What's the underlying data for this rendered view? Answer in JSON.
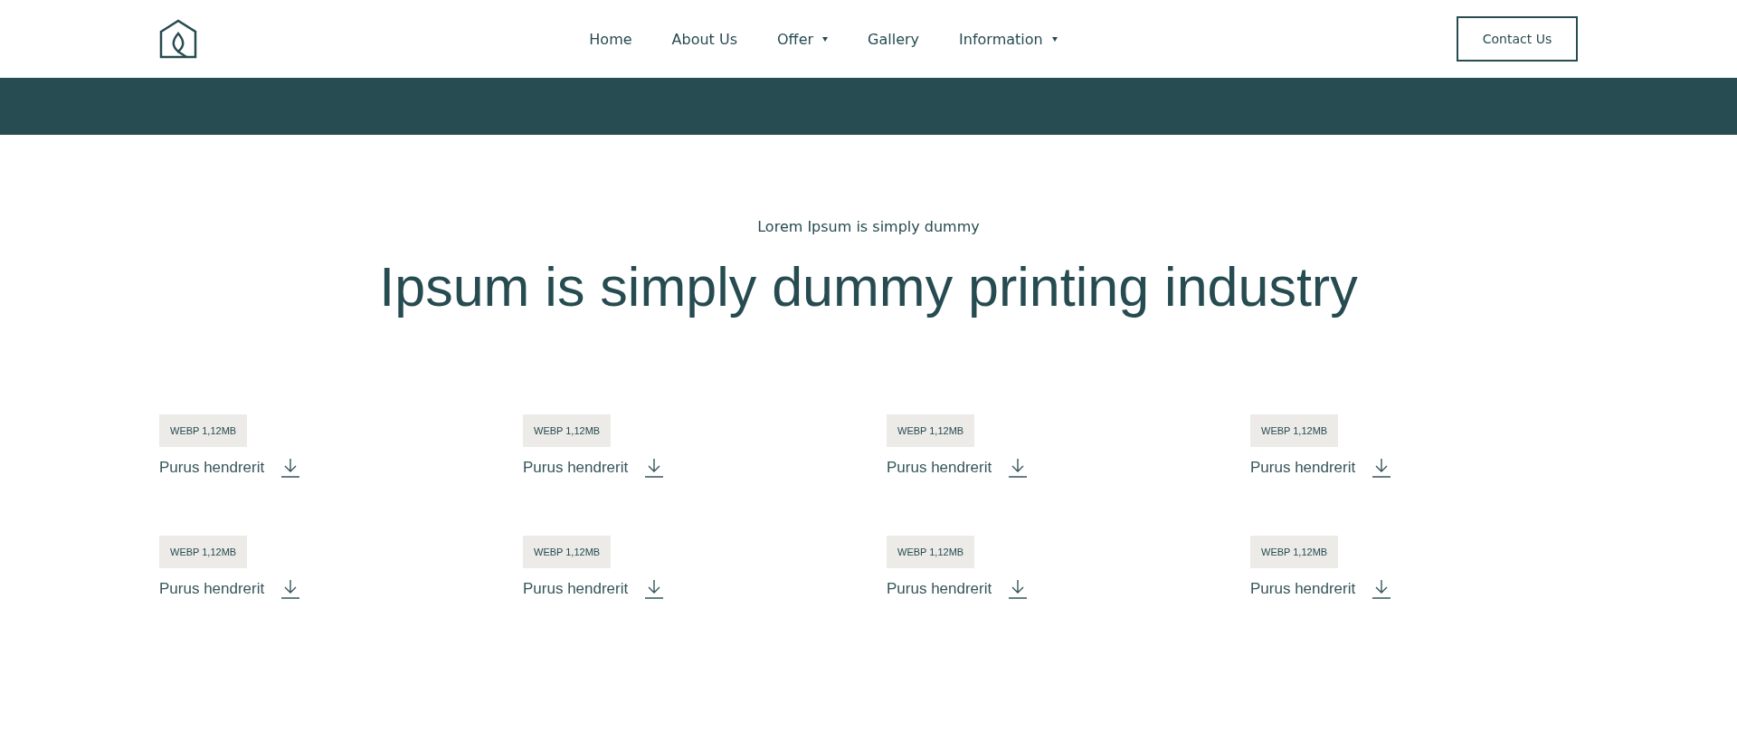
{
  "nav": {
    "items": [
      {
        "label": "Home",
        "has_dropdown": false
      },
      {
        "label": "About Us",
        "has_dropdown": false
      },
      {
        "label": "Offer",
        "has_dropdown": true
      },
      {
        "label": "Gallery",
        "has_dropdown": false
      },
      {
        "label": "Information",
        "has_dropdown": true
      }
    ],
    "cta": "Contact Us"
  },
  "section": {
    "eyebrow": "Lorem Ipsum is simply dummy",
    "heading": "Ipsum is simply dummy printing industry"
  },
  "files": [
    {
      "badge": "WEBP 1,12MB",
      "name": "Purus hendrerit"
    },
    {
      "badge": "WEBP 1,12MB",
      "name": "Purus hendrerit"
    },
    {
      "badge": "WEBP 1,12MB",
      "name": "Purus hendrerit"
    },
    {
      "badge": "WEBP 1,12MB",
      "name": "Purus hendrerit"
    },
    {
      "badge": "WEBP 1,12MB",
      "name": "Purus hendrerit"
    },
    {
      "badge": "WEBP 1,12MB",
      "name": "Purus hendrerit"
    },
    {
      "badge": "WEBP 1,12MB",
      "name": "Purus hendrerit"
    },
    {
      "badge": "WEBP 1,12MB",
      "name": "Purus hendrerit"
    }
  ]
}
